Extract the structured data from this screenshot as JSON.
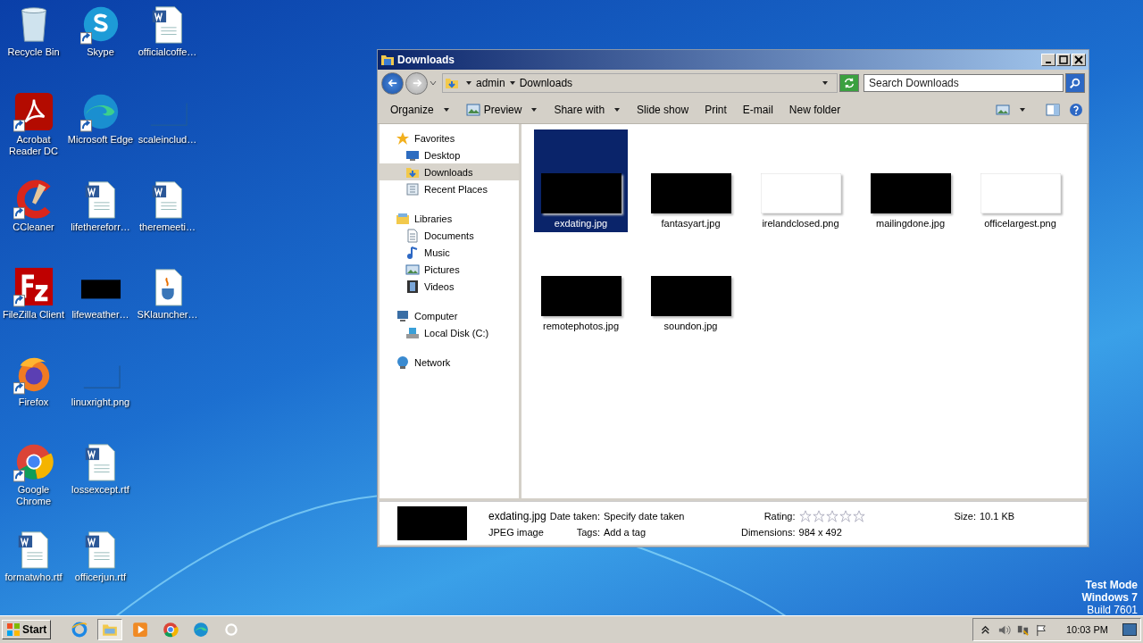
{
  "desktop_icons": [
    {
      "label": "Recycle Bin",
      "kind": "recycle",
      "shortcut": false
    },
    {
      "label": "Acrobat Reader DC",
      "kind": "pdf",
      "shortcut": true
    },
    {
      "label": "CCleaner",
      "kind": "ccleaner",
      "shortcut": true
    },
    {
      "label": "FileZilla Client",
      "kind": "filezilla",
      "shortcut": true
    },
    {
      "label": "Firefox",
      "kind": "firefox",
      "shortcut": true
    },
    {
      "label": "Google Chrome",
      "kind": "chrome",
      "shortcut": true
    },
    {
      "label": "formatwho.rtf",
      "kind": "word",
      "shortcut": false
    },
    {
      "label": "Skype",
      "kind": "skype",
      "shortcut": true
    },
    {
      "label": "Microsoft Edge",
      "kind": "edge",
      "shortcut": true
    },
    {
      "label": "lifethereforr…",
      "kind": "word",
      "shortcut": false
    },
    {
      "label": "lifeweather…",
      "kind": "dark",
      "shortcut": false
    },
    {
      "label": "linuxright.png",
      "kind": "blank",
      "shortcut": false
    },
    {
      "label": "lossexcept.rtf",
      "kind": "word",
      "shortcut": false
    },
    {
      "label": "officerjun.rtf",
      "kind": "word",
      "shortcut": false
    },
    {
      "label": "officialcoffe…",
      "kind": "word",
      "shortcut": false
    },
    {
      "label": "scaleinclud…",
      "kind": "blank",
      "shortcut": false
    },
    {
      "label": "theremeeti…",
      "kind": "word",
      "shortcut": false
    },
    {
      "label": "SKlauncher…",
      "kind": "java",
      "shortcut": false
    }
  ],
  "window": {
    "title": "Downloads",
    "breadcrumb": [
      "admin",
      "Downloads"
    ],
    "search": {
      "placeholder": "Search Downloads"
    },
    "toolbar": [
      {
        "label": "Organize",
        "dropdown": true,
        "icon": false
      },
      {
        "label": "Preview",
        "dropdown": true,
        "icon": true
      },
      {
        "label": "Share with",
        "dropdown": true,
        "icon": false
      },
      {
        "label": "Slide show",
        "dropdown": false,
        "icon": false
      },
      {
        "label": "Print",
        "dropdown": false,
        "icon": false
      },
      {
        "label": "E-mail",
        "dropdown": false,
        "icon": false
      },
      {
        "label": "New folder",
        "dropdown": false,
        "icon": false
      }
    ],
    "nav": [
      {
        "label": "Favorites",
        "kind": "star",
        "selected": false,
        "children": [
          {
            "label": "Desktop",
            "kind": "desktop",
            "selected": false
          },
          {
            "label": "Downloads",
            "kind": "folder",
            "selected": true
          },
          {
            "label": "Recent Places",
            "kind": "recent",
            "selected": false
          }
        ]
      },
      {
        "label": "Libraries",
        "kind": "library",
        "selected": false,
        "children": [
          {
            "label": "Documents",
            "kind": "doc",
            "selected": false
          },
          {
            "label": "Music",
            "kind": "music",
            "selected": false
          },
          {
            "label": "Pictures",
            "kind": "pictures",
            "selected": false
          },
          {
            "label": "Videos",
            "kind": "video",
            "selected": false
          }
        ]
      },
      {
        "label": "Computer",
        "kind": "computer",
        "selected": false,
        "children": [
          {
            "label": "Local Disk (C:)",
            "kind": "disk",
            "selected": false
          }
        ]
      },
      {
        "label": "Network",
        "kind": "network",
        "selected": false
      }
    ],
    "files": [
      {
        "name": "exdating.jpg",
        "dark": true,
        "selected": true
      },
      {
        "name": "fantasyart.jpg",
        "dark": true,
        "selected": false
      },
      {
        "name": "irelandclosed.png",
        "dark": false,
        "selected": false
      },
      {
        "name": "mailingdone.jpg",
        "dark": true,
        "selected": false
      },
      {
        "name": "officelargest.png",
        "dark": false,
        "selected": false
      },
      {
        "name": "remotephotos.jpg",
        "dark": true,
        "selected": false
      },
      {
        "name": "soundon.jpg",
        "dark": true,
        "selected": false
      }
    ],
    "details": {
      "name": "exdating.jpg",
      "type": "JPEG image",
      "date_label": "Date taken:",
      "date_value": "Specify date taken",
      "tags_label": "Tags:",
      "tags_value": "Add a tag",
      "rating_label": "Rating:",
      "stars": 0,
      "size_label": "Size:",
      "size_value": "10.1 KB",
      "dimensions_label": "Dimensions:",
      "dimensions_value": "984 x 492"
    }
  },
  "taskbar": {
    "start": "Start",
    "apps": [
      {
        "kind": "ie",
        "active": false
      },
      {
        "kind": "explorer",
        "active": true
      },
      {
        "kind": "media",
        "active": false
      },
      {
        "kind": "chrome",
        "active": false
      },
      {
        "kind": "edge",
        "active": false
      },
      {
        "kind": "generic",
        "active": false
      }
    ],
    "time": "10:03 PM"
  },
  "test_mode": [
    "Test Mode",
    "Windows 7",
    "Build 7601"
  ]
}
